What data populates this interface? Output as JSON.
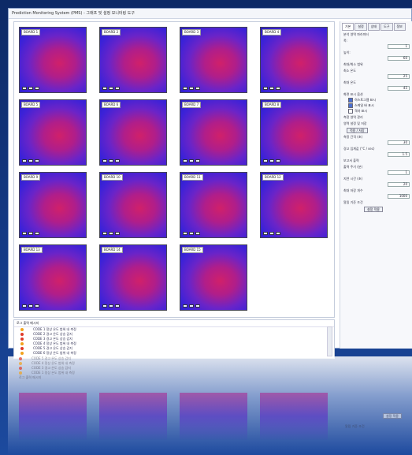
{
  "window": {
    "title": "Prediction Monitoring System (PMS) - 그래프 및 설정 모니터링 도구"
  },
  "cells": [
    {
      "label": "BOARD 1"
    },
    {
      "label": "BOARD 2"
    },
    {
      "label": "BOARD 3"
    },
    {
      "label": "BOARD 4"
    },
    {
      "label": "BOARD 5"
    },
    {
      "label": "BOARD 6"
    },
    {
      "label": "BOARD 7"
    },
    {
      "label": "BOARD 8"
    },
    {
      "label": "BOARD 9"
    },
    {
      "label": "BOARD 10"
    },
    {
      "label": "BOARD 11"
    },
    {
      "label": "BOARD 12"
    },
    {
      "label": "BOARD 13"
    },
    {
      "label": "BOARD 14"
    },
    {
      "label": "BOARD 15"
    }
  ],
  "side": {
    "tabs": [
      "기본",
      "설정",
      "상태",
      "도구",
      "정보"
    ],
    "section1": "분석 영역 파라미터",
    "label_width": "폭:",
    "value_width": "1",
    "label_height": "높이:",
    "value_height": "60",
    "section2": "최대/최소 범위",
    "label_min": "최소 온도",
    "value_min": "25",
    "label_max": "최대 온도",
    "value_max": "45",
    "section3": "화면 표시 옵션",
    "check1": "히스토그램 표시",
    "check2": "스케일 바 표시",
    "check3": "격자 표시",
    "section4": "측정 영역 관리",
    "sub4": "영역 설정 및 저장",
    "btn_apply": "적용 / 저장",
    "label_interval": "측정 간격 (초)",
    "value_interval": "30",
    "label_limit": "경고 임계값 (°C / sec)",
    "value_limit": "1.5",
    "section5": "보고서 출력",
    "label_period": "출력 주기 (분)",
    "value_period": "1",
    "label_delay": "지연 시간 (초)",
    "value_delay": "20",
    "label_count": "최대 저장 개수",
    "value_count": "1000",
    "section6": "알림 기준 조건",
    "btn_set": "설정 적용"
  },
  "log": {
    "header": "로그 출력 메시지",
    "rows": [
      {
        "text": "CODE 1  정상 온도 범위 내 측정",
        "color": "#f2a21c"
      },
      {
        "text": "CODE 2  경고 온도 상승 감지",
        "color": "#e03a2a"
      },
      {
        "text": "CODE 3  경고 온도 상승 감지",
        "color": "#e03a2a"
      },
      {
        "text": "CODE 4  정상 온도 범위 내 측정",
        "color": "#f2a21c"
      },
      {
        "text": "CODE 5  경고 온도 상승 감지",
        "color": "#e03a2a"
      },
      {
        "text": "CODE 6  정상 온도 범위 내 측정",
        "color": "#f2a21c"
      }
    ]
  },
  "reflection": {
    "header": "로그 출력 메시지",
    "btn": "설정 적용",
    "label": "알림 기준 조건"
  }
}
